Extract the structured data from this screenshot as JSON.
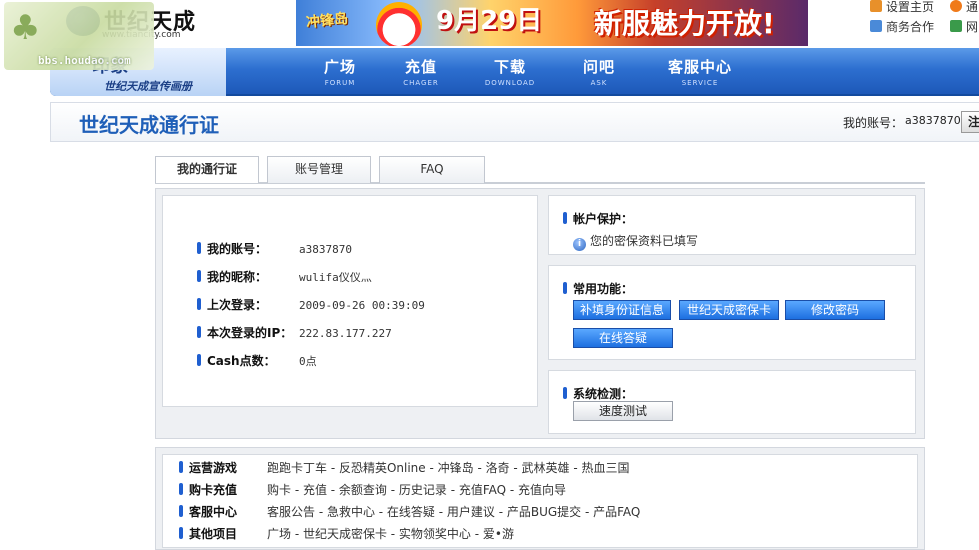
{
  "watermark": {
    "text": "bbs.houdao.com"
  },
  "header": {
    "logo_text": "世纪天成",
    "logo_url": "www.tiancity.com",
    "banner": {
      "game": "冲锋岛",
      "date": "9月29日",
      "slogan": "新服魅力开放!"
    },
    "top_links": [
      {
        "label": "设置主页",
        "icon": "house-icon",
        "color": "#e8902a"
      },
      {
        "label": "通",
        "icon": "orange-dot-icon",
        "color": "#f07a1a"
      },
      {
        "label": "商务合作",
        "icon": "chat-icon",
        "color": "#4a8ad8"
      },
      {
        "label": "网",
        "icon": "square-icon",
        "color": "#3a9a4a"
      }
    ]
  },
  "nav": {
    "logo_main": "印象",
    "logo_sub": "世纪天成宣传画册",
    "items": [
      {
        "cn": "广场",
        "en": "FORUM"
      },
      {
        "cn": "充值",
        "en": "CHAGER"
      },
      {
        "cn": "下载",
        "en": "DOWNLOAD"
      },
      {
        "cn": "问吧",
        "en": "ASK"
      },
      {
        "cn": "客服中心",
        "en": "SERVICE"
      }
    ]
  },
  "titlebar": {
    "title": "世纪天成通行证",
    "account_label": "我的账号：",
    "account_value": "a3837870",
    "logout_label": "注"
  },
  "tabs": [
    "我的通行证",
    "账号管理",
    "FAQ"
  ],
  "account_info": [
    {
      "label": "我的账号：",
      "value": "a3837870"
    },
    {
      "label": "我的昵称：",
      "value": "wulifa仪仪灬"
    },
    {
      "label": "上次登录：",
      "value": "2009-09-26 00:39:09"
    },
    {
      "label": "本次登录的IP：",
      "value": "222.83.177.227"
    },
    {
      "label": "Cash点数：",
      "value": "0点"
    }
  ],
  "protection": {
    "title": "帐户保护：",
    "status": "您的密保资料已填写"
  },
  "functions": {
    "title": "常用功能：",
    "buttons": [
      "补填身份证信息",
      "世纪天成密保卡",
      "修改密码",
      "在线答疑"
    ]
  },
  "system_check": {
    "title": "系统检测：",
    "button": "速度测试"
  },
  "footer": [
    {
      "label": "运营游戏",
      "links": "跑跑卡丁车 - 反恐精英Online - 冲锋岛 - 洛奇 - 武林英雄 - 热血三国"
    },
    {
      "label": "购卡充值",
      "links": "购卡 - 充值 - 余额查询 - 历史记录 - 充值FAQ - 充值向导"
    },
    {
      "label": "客服中心",
      "links": "客服公告 - 急救中心 - 在线答疑 - 用户建议 - 产品BUG提交 - 产品FAQ"
    },
    {
      "label": "其他项目",
      "links": "广场 - 世纪天成密保卡 - 实物领奖中心 - 爱•游"
    }
  ]
}
